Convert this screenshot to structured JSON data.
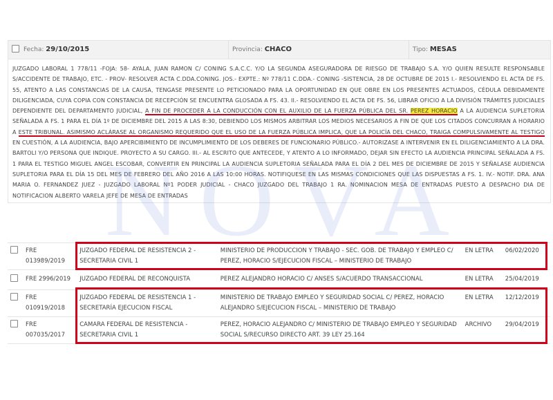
{
  "notice": {
    "fecha_label": "Fecha:",
    "fecha_value": "29/10/2015",
    "provincia_label": "Provincia:",
    "provincia_value": "CHACO",
    "tipo_label": "Tipo:",
    "tipo_value": "MESAS",
    "body_part1": "JUZGADO LABORAL 1 778/11 -FOJA: 58- AYALA, JUAN RAMON C/ CONING S.A.C.C. Y/O LA SEGUNDA ASEGURADORA DE RIESGO DE TRABAJO S.A. Y/O QUIEN RESULTE RESPONSABLE S/ACCIDENTE DE TRABAJO, ETC. - PROV- RESOLVER ACTA C.DDA.CONING. JOS.- EXPTE.: Nº 778/11 C.DDA.- CONING -SISTENCIA, 28 DE OCTUBRE DE 2015 I.- RESOLVIENDO EL ACTA DE FS. 55, ATENTO A LAS CONSTANCIAS DE LA CAUSA, TENGASE PRESENTE LO PETICIONADO PARA LA OPORTUNIDAD EN QUE OBRE EN LOS PRESENTES ACTUADOS, CÉDULA DEBIDAMENTE DILIGENCIADA, CUYA COPIA CON CONSTANCIA DE RECEPCIÓN SE ENCUENTRA GLOSADA A FS. 43. II.- RESOLVIENDO EL ACTA DE FS. 56, LIBRAR OFICIO A LA DIVISIÓN TRÁMITES JUDICIALES DEPENDIENTE DEL DEPARTAMENTO JUDICIAL, ",
    "body_ul1": "A FIN DE PROCEDER A LA CONDUCCIÓN CON EL AUXILIO DE LA FUERZA PÚBLICA DEL SR. ",
    "body_highlight": "PEREZ HORACIO",
    "body_part2": " A LA AUDIENCIA SUPLETORIA SEÑALADA A FS. 1 PARA EL DÍA 1º DE DICIEMBRE DEL 2015 A LAS 8:30, DEBIENDO LOS MISMOS ARBITRAR LOS MEDIOS NECESARIOS A FIN DE QUE LOS CITADOS CONCURRAN A HORARIO A ",
    "body_ul2": "ESTE TRIBUNAL. ASIMISMO ACLÁRASE AL ORGANISMO REQUERIDO QUE EL USO DE LA FUERZA PÚBLICA IMPLICA, QUE LA POLICÍA DEL CHACO, TRAIGA COMPULSIVAMENTE AL TESTIGO",
    "body_part3": " EN CUESTIÓN, A LA AUDIENCIA, BAJO APERCIBIMIENTO DE INCUMPLIMIENTO DE LOS DEBERES DE FUNCIONARIO PÚBLICO.- AUTORIZASE A INTERVENIR EN EL DILIGENCIAMIENTO A LA DRA. BARTOLI Y/O PERSONA QUE INDIQUE. PROYECTO A SU CARGO. III.- AL ESCRITO QUE ANTECEDE, Y ATENTO A LO INFORMADO, DEJAR SIN EFECTO LA AUDIENCIA PRINCIPAL SEÑALADA A FS. 1 PARA EL TESTIGO MIGUEL ANGEL ESCOBAR, CONVERTIR EN PRINCIPAL LA AUDIENCIA SUPLETORIA SEÑALADA PARA EL DÍA 2 DEL MES DE DICIEMBRE DE 2015 Y SEÑALASE AUDIENCIA SUPLETORIA PARA EL DÍA 15 DEL MES DE FEBRERO DEL AÑO 2016 A LAS 10:00 HORAS. NOTIFIQUESE EN LAS MISMAS CONDICIONES QUE LAS DISPUESTAS A FS. 1. IV.- NOTIF. DRA. ANA MARIA O. FERNANDEZ JUEZ - JUZGADO LABORAL Nº1 PODER JUDICIAL - CHACO JUZGADO DEL TRABAJO 1 RA. NOMINACION MESA DE ENTRADAS PUESTO A DESPACHO DIA DE NOTIFICACION ALBERTO VARELA JEFE DE MESA DE ENTRADAS"
  },
  "watermark": "NOVA",
  "cases": [
    {
      "exp1": "FRE",
      "exp2": "013989/2019",
      "court1": "JUZGADO FEDERAL DE RESISTENCIA 2 -",
      "court2": "SECRETARIA CIVIL 1",
      "case1": "MINISTERIO DE PRODUCCION Y TRABAJO - SEC. GOB. DE TRABAJO Y EMPLEO C/",
      "case2": "PEREZ, HORACIO S/EJECUCION FISCAL – MINISTERIO DE TRABAJO",
      "state": "EN LETRA",
      "date": "06/02/2020"
    },
    {
      "exp1": "FRE 2996/2019",
      "court1": "JUZGADO FEDERAL DE RECONQUISTA",
      "case1": "PEREZ ALEJANDRO HORACIO C/ ANSES S/ACUERDO TRANSACCIONAL",
      "state": "EN LETRA",
      "date": "25/04/2019"
    },
    {
      "exp1": "FRE",
      "exp2": "010919/2018",
      "court1": "JUZGADO FEDERAL DE RESISTENCIA 1 -",
      "court2": "SECRETARÍA EJECUCION FISCAL",
      "case1": "MINISTERIO DE TRABAJO EMPLEO Y SEGURIDAD SOCIAL C/ PEREZ, HORACIO",
      "case2": "ALEJANDRO S/EJECUCION FISCAL – MINISTERIO DE TRABAJO",
      "state": "EN LETRA",
      "date": "12/12/2019"
    },
    {
      "exp1": "FRE",
      "exp2": "007035/2017",
      "court1": "CAMARA FEDERAL DE RESISTENCIA -",
      "court2": "SECRETARIA CIVIL 1",
      "case1": "PEREZ, HORACIO ALEJANDRO C/ MINISTERIO DE TRABAJO EMPLEO Y SEGURIDAD",
      "case2": "SOCIAL S/RECURSO DIRECTO ART. 39 LEY 25.164",
      "state": "ARCHIVO",
      "date": "29/04/2019"
    }
  ]
}
